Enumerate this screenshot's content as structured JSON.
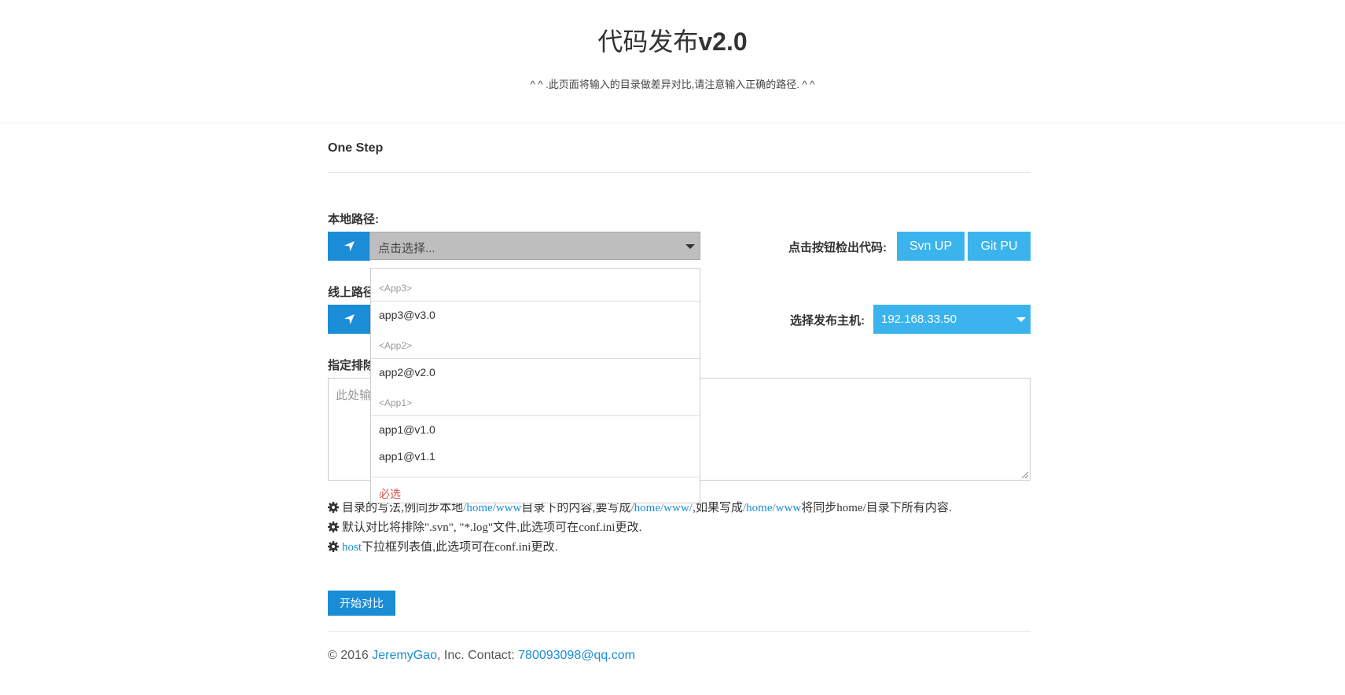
{
  "header": {
    "title_prefix": "代码发布",
    "title_version": "v2.0",
    "subtitle": "^ ^ .此页面将输入的目录做差异对比,请注意输入正确的路径. ^ ^"
  },
  "section": {
    "title": "One Step"
  },
  "local_path": {
    "label": "本地路径:",
    "placeholder": "点击选择...",
    "icon": "location-arrow-icon"
  },
  "checkout": {
    "label": "点击按钮检出代码:",
    "svn_label": "Svn UP",
    "git_label": "Git PU"
  },
  "online_path": {
    "label_visible": "线上路径"
  },
  "host": {
    "label": "选择发布主机:",
    "value": "192.168.33.50"
  },
  "exclude": {
    "label_visible": "指定排除",
    "placeholder_visible": "此处输"
  },
  "dropdown": {
    "groups": [
      {
        "label": "<App3>",
        "options": [
          "app3@v3.0"
        ]
      },
      {
        "label": "<App2>",
        "options": [
          "app2@v2.0"
        ]
      },
      {
        "label": "<App1>",
        "options": [
          "app1@v1.0",
          "app1@v1.1"
        ]
      }
    ],
    "required_note": "必选"
  },
  "tips": [
    {
      "pre_visible": "目录的写法,例同步本地",
      "path1": "/home/www",
      "mid1": "目录下的内容,要写成",
      "path2": "/home/www/",
      "mid2": ",如果写成",
      "path3": "/home/www",
      "mid3": "将同步",
      "path4": "home/",
      "post": "目录下所有内容."
    },
    {
      "pre": "默认对比将排除",
      "ext": "\".svn\", \"*.log\"",
      "mid": "文件,此选项可在",
      "conf": "conf.ini",
      "post": "更改."
    },
    {
      "host": "host",
      "mid": "下拉框列表值,此选项可在",
      "conf": "conf.ini",
      "post": "更改."
    }
  ],
  "actions": {
    "compare_label": "开始对比"
  },
  "footer": {
    "prefix": "© 2016 ",
    "author": "JeremyGao",
    "mid": ", Inc. Contact: ",
    "email": "780093098@qq.com"
  },
  "colors": {
    "primary": "#1a8dd6",
    "button_light": "#3bb4ee",
    "select_gray": "#bebebe",
    "required_red": "#d9534f"
  }
}
